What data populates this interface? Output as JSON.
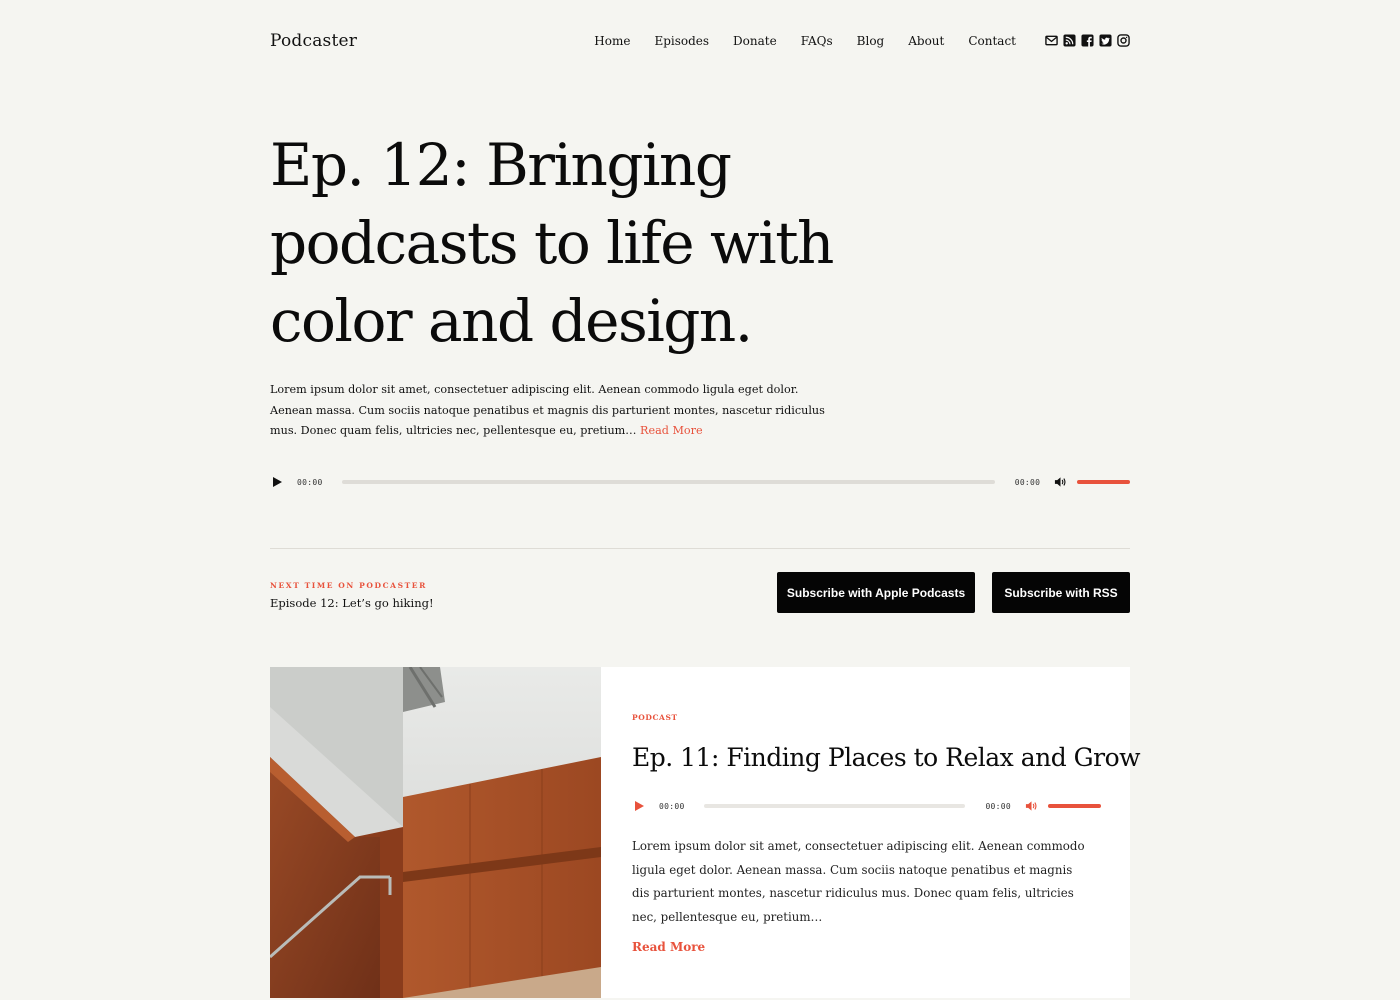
{
  "header": {
    "logo": "Podcaster",
    "nav": [
      "Home",
      "Episodes",
      "Donate",
      "FAQs",
      "Blog",
      "About",
      "Contact"
    ],
    "social_icons": [
      "mail-icon",
      "rss-icon",
      "facebook-icon",
      "twitter-icon",
      "instagram-icon"
    ]
  },
  "hero": {
    "title": "Ep. 12: Bringing podcasts to life with color and design.",
    "description": "Lorem ipsum dolor sit amet, consectetuer adipiscing elit. Aenean commodo ligula eget dolor. Aenean massa. Cum sociis natoque penatibus et magnis dis parturient montes, nascetur ridiculus mus. Donec quam felis, ultricies nec, pellentesque eu, pretium…",
    "read_more": "Read More",
    "player": {
      "current_time": "00:00",
      "duration": "00:00",
      "progress": 0,
      "volume": 1.0
    }
  },
  "next": {
    "label": "NEXT TIME ON PODCASTER",
    "episode": "Episode 12: Let’s go hiking!"
  },
  "buttons": {
    "apple": "Subscribe with Apple Podcasts",
    "rss": "Subscribe with RSS"
  },
  "card": {
    "category": "PODCAST",
    "title": "Ep. 11: Finding Places to Relax and Grow",
    "player": {
      "current_time": "00:00",
      "duration": "00:00",
      "progress": 0,
      "volume": 1.0
    },
    "description": "Lorem ipsum dolor sit amet, consectetuer adipiscing elit. Aenean commodo ligula eget dolor. Aenean massa. Cum sociis natoque penatibus et magnis dis parturient montes, nascetur ridiculus mus. Donec quam felis, ultricies nec, pellentesque eu, pretium…",
    "read_more": "Read More"
  },
  "colors": {
    "accent": "#e8523c",
    "background": "#f5f5f1",
    "text": "#111111",
    "button": "#050505"
  }
}
